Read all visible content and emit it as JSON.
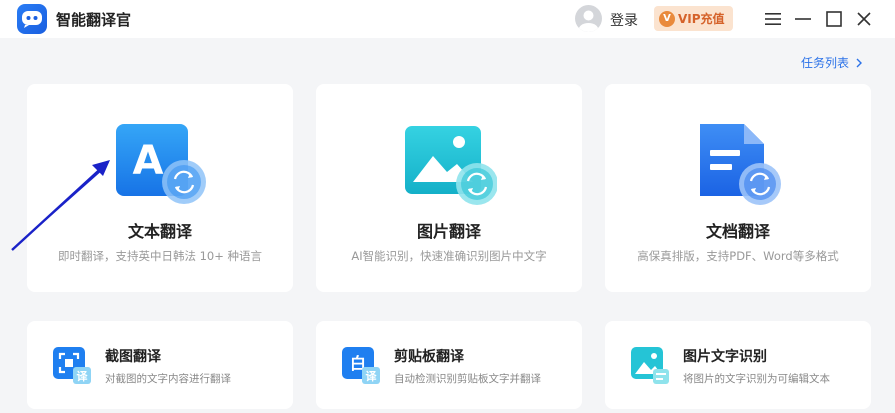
{
  "app": {
    "title": "智能翻译官",
    "login_label": "登录",
    "vip_label": "VIP充值",
    "vip_icon_letter": "V"
  },
  "task_list": {
    "label": "任务列表"
  },
  "big_cards": [
    {
      "title": "文本翻译",
      "desc": "即时翻译，支持英中日韩法 10+ 种语言",
      "icon": "text-translate-icon",
      "glyph": "A"
    },
    {
      "title": "图片翻译",
      "desc": "AI智能识别，快速准确识别图片中文字",
      "icon": "image-translate-icon"
    },
    {
      "title": "文档翻译",
      "desc": "高保真排版，支持PDF、Word等多格式",
      "icon": "document-translate-icon"
    }
  ],
  "small_cards": [
    {
      "title": "截图翻译",
      "desc": "对截图的文字内容进行翻译",
      "icon": "screenshot-translate-icon",
      "badge": "译"
    },
    {
      "title": "剪贴板翻译",
      "desc": "自动检测识别剪贴板文字并翻译",
      "icon": "clipboard-translate-icon",
      "badge": "译",
      "glyph": "白"
    },
    {
      "title": "图片文字识别",
      "desc": "将图片的文字识别为可编辑文本",
      "icon": "image-ocr-icon"
    }
  ],
  "colors": {
    "accent_blue": "#2b72e8",
    "teal": "#25c4d6",
    "vip_bg": "#fbe3cf",
    "vip_text": "#d5622a"
  }
}
